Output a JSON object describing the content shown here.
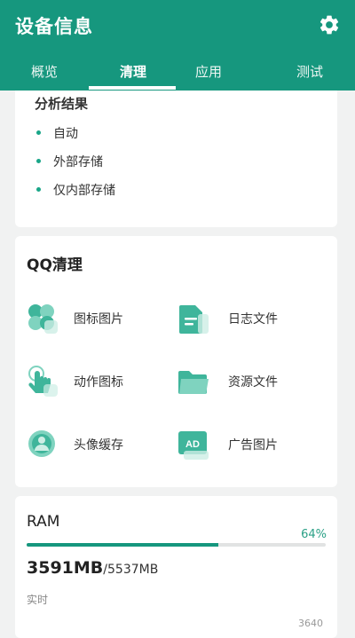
{
  "app": {
    "title": "设备信息",
    "accent": "#16977e"
  },
  "toolbar": {
    "settings_icon": "gear-icon"
  },
  "tabs": [
    {
      "label": "概览",
      "active": false
    },
    {
      "label": "清理",
      "active": true
    },
    {
      "label": "应用",
      "active": false
    },
    {
      "label": "测试",
      "active": false
    }
  ],
  "analysis": {
    "title": "分析结果",
    "items": [
      "自动",
      "外部存储",
      "仅内部存储"
    ]
  },
  "qq_clean": {
    "title": "QQ清理",
    "items": [
      {
        "label": "图标图片",
        "icon": "clover-icon"
      },
      {
        "label": "日志文件",
        "icon": "document-icon"
      },
      {
        "label": "动作图标",
        "icon": "tap-hand-icon"
      },
      {
        "label": "资源文件",
        "icon": "folder-icon"
      },
      {
        "label": "头像缓存",
        "icon": "avatar-icon"
      },
      {
        "label": "广告图片",
        "icon": "ad-image-icon"
      }
    ]
  },
  "ram": {
    "title": "RAM",
    "percent_text": "64%",
    "fill_fraction": 0.64,
    "used": "3591MB",
    "total": "/5537MB",
    "realtime_label": "实时",
    "axis_max": "3640"
  }
}
